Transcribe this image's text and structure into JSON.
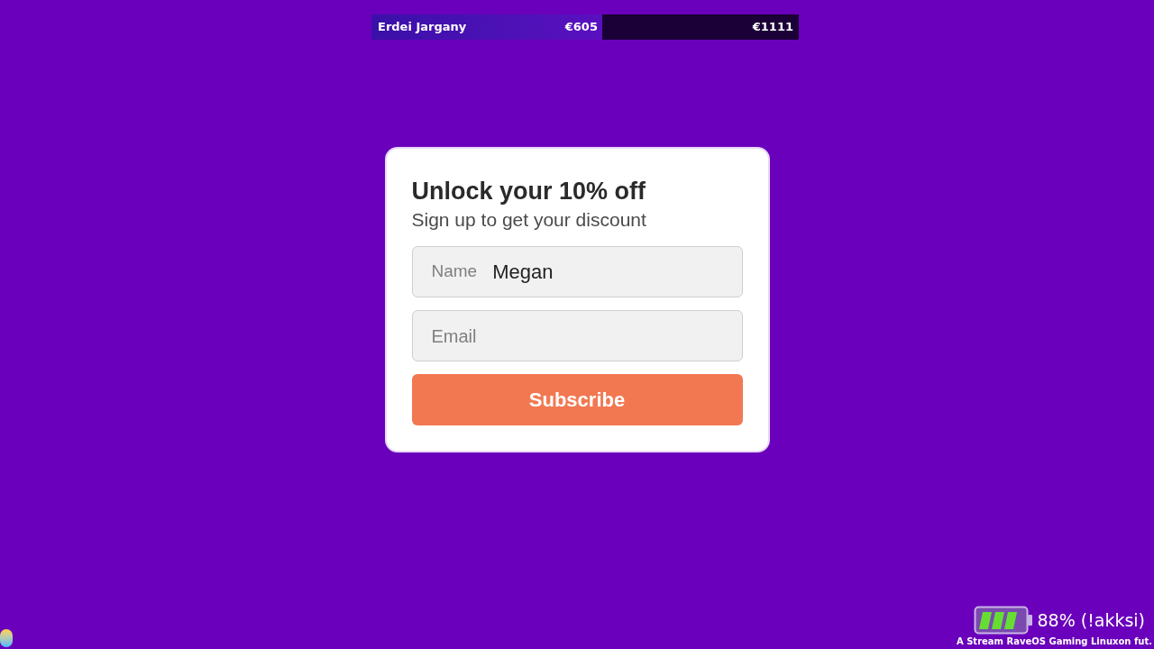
{
  "goal_bar": {
    "name": "Erdei Jargany",
    "raised": "€605",
    "goal": "€1111",
    "level": 0.54
  },
  "signup": {
    "title": "Unlock your 10% off",
    "subtitle": "Sign up to get your discount",
    "fields": [
      {
        "label": "Name",
        "value": "Megan"
      },
      {
        "placeholder": "Email"
      }
    ],
    "button": "Subscribe"
  },
  "overlay": {
    "battery_text": "88% (!akksi)",
    "caption": "A Stream RaveOS Gaming Linuxon fut."
  }
}
